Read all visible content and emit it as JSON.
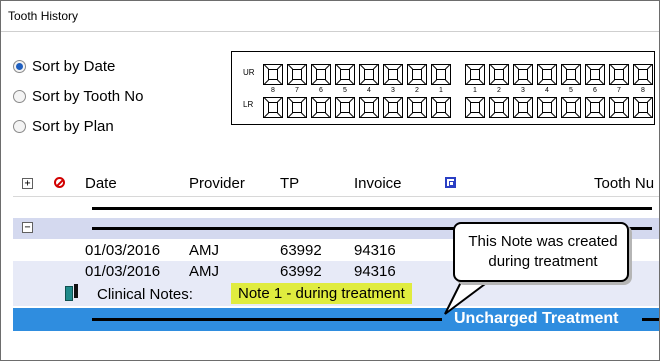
{
  "window": {
    "title": "Tooth History"
  },
  "sort": {
    "options": [
      {
        "label": "Sort by Date",
        "checked": true
      },
      {
        "label": "Sort by Tooth No",
        "checked": false
      },
      {
        "label": "Sort by Plan",
        "checked": false
      }
    ]
  },
  "tooth_chart": {
    "upper_label": "UR",
    "lower_label": "LR",
    "numbers_right": [
      "8",
      "7",
      "6",
      "5",
      "4",
      "3",
      "2",
      "1"
    ],
    "numbers_left": [
      "1",
      "2",
      "3",
      "4",
      "5",
      "6",
      "7",
      "8"
    ]
  },
  "grid": {
    "columns": {
      "expand": "+",
      "date": "Date",
      "provider": "Provider",
      "tp": "TP",
      "invoice": "Invoice",
      "tooth_no": "Tooth Nu"
    },
    "group_toggle": "−",
    "rows": [
      {
        "date": "01/03/2016",
        "provider": "AMJ",
        "tp": "63992",
        "invoice": "94316"
      },
      {
        "date": "01/03/2016",
        "provider": "AMJ",
        "tp": "63992",
        "invoice": "94316"
      }
    ],
    "clinical_notes_label": "Clinical Notes:",
    "clinical_note_value": "Note 1 - during treatment",
    "uncharged_label": "Uncharged Treatment"
  },
  "callout": {
    "text": "This Note was created during treatment"
  },
  "colors": {
    "group_row": "#d4d9ef",
    "data_row_alt": "#e7eaf7",
    "selected_row": "#2f8ddf",
    "note_highlight": "#e0ec3f"
  }
}
